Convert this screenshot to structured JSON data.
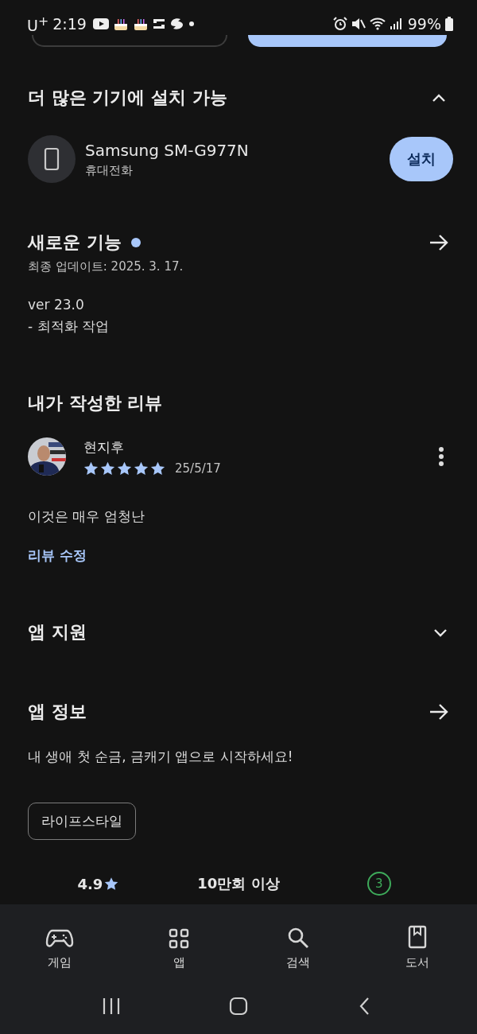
{
  "status_bar": {
    "carrier": "U$^{+}$",
    "time": "2:19",
    "battery": "99%"
  },
  "devices": {
    "title": "더 많은 기기에 설치 가능",
    "expanded": true,
    "device_name": "Samsung SM-G977N",
    "device_type": "휴대전화",
    "install_button": "설치"
  },
  "whats_new": {
    "title": "새로운 기능",
    "unread": true,
    "updated": "최종 업데이트: 2025. 3. 17.",
    "notes": [
      "ver 23.0",
      "- 최적화 작업"
    ]
  },
  "my_review": {
    "title": "내가 작성한 리뷰",
    "reviewer": "현지후",
    "stars": 5,
    "date": "25/5/17",
    "text": "이것은 매우 엄청난",
    "edit_link": "리뷰 수정"
  },
  "app_support": {
    "title": "앱 지원",
    "expanded": false
  },
  "app_info": {
    "title": "앱 정보",
    "description": "내 생애 첫 순금, 금캐기 앱으로 시작하세요!",
    "tag": "라이프스타일"
  },
  "stats": [
    {
      "kind": "rating",
      "value": "4.9"
    },
    {
      "kind": "downloads",
      "value": "10만회 이상"
    },
    {
      "kind": "age",
      "value": "3"
    }
  ],
  "nav": [
    {
      "kind": "games",
      "label": "게임"
    },
    {
      "kind": "apps",
      "label": "앱"
    },
    {
      "kind": "search",
      "label": "검색"
    },
    {
      "kind": "books",
      "label": "도서"
    }
  ]
}
